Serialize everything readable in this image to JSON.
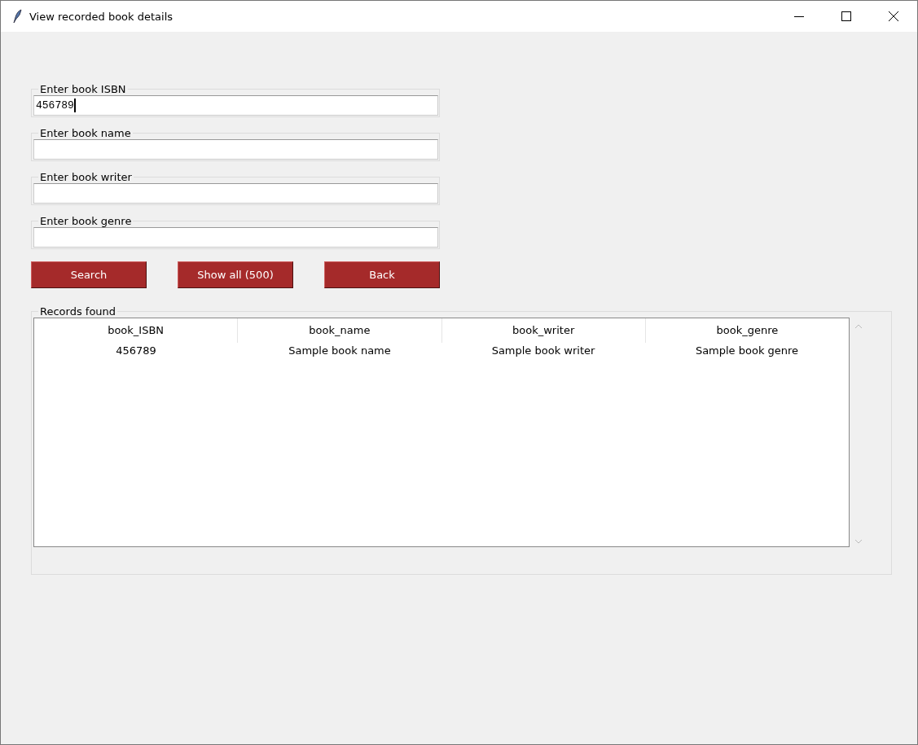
{
  "window": {
    "title": "View recorded book details"
  },
  "fields": [
    {
      "label": "Enter book ISBN",
      "value": "456789",
      "focused": true
    },
    {
      "label": "Enter book name",
      "focused": false
    },
    {
      "label": "Enter book writer",
      "focused": false
    },
    {
      "label": "Enter book genre",
      "focused": false
    }
  ],
  "buttons": [
    "Search",
    "Show all (500)",
    "Back"
  ],
  "records": {
    "title": "Records found",
    "columns": [
      "book_ISBN",
      "book_name",
      "book_writer",
      "book_genre"
    ],
    "rows": [
      [
        "456789",
        "Sample book name",
        "Sample book writer",
        "Sample book genre"
      ]
    ]
  }
}
